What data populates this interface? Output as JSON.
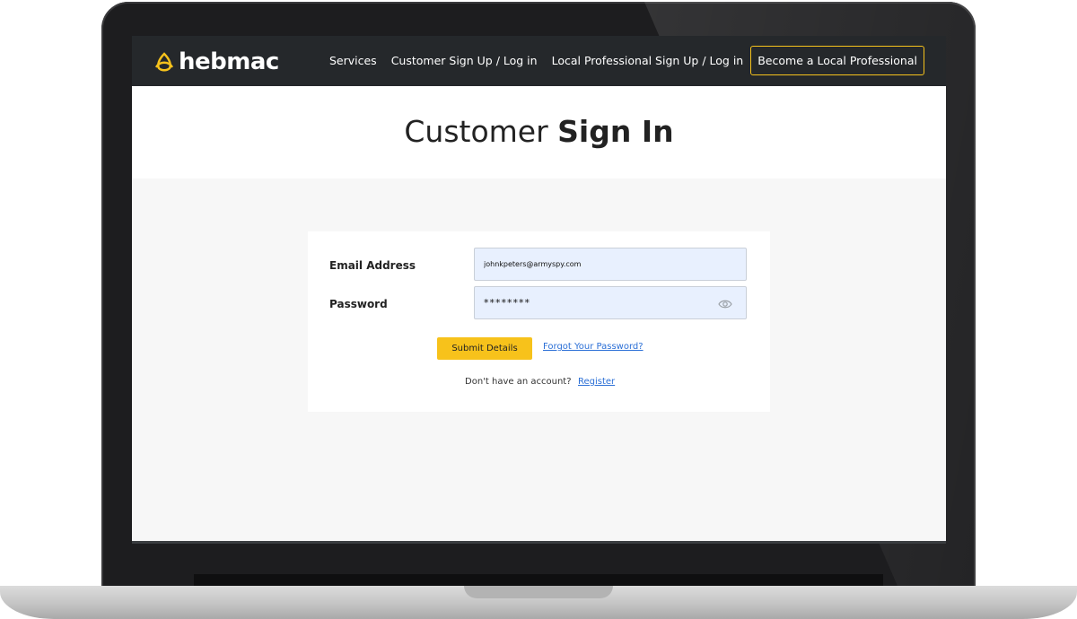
{
  "brand": {
    "name": "hebmac",
    "accent_color": "#f6c21c",
    "logo_icon": "triquetra-icon"
  },
  "nav": {
    "links": [
      "Services",
      "Customer Sign Up / Log in",
      "Local Professional Sign Up / Log in"
    ],
    "cta_label": "Become a Local Professional"
  },
  "page": {
    "title_light": "Customer ",
    "title_bold": "Sign In"
  },
  "form": {
    "email_label": "Email Address",
    "email_value": "johnkpeters@armyspy.com",
    "password_label": "Password",
    "password_value": "********",
    "submit_label": "Submit Details",
    "forgot_label": "Forgot Your Password?",
    "no_account_text": "Don't have an account?",
    "register_label": "Register"
  }
}
